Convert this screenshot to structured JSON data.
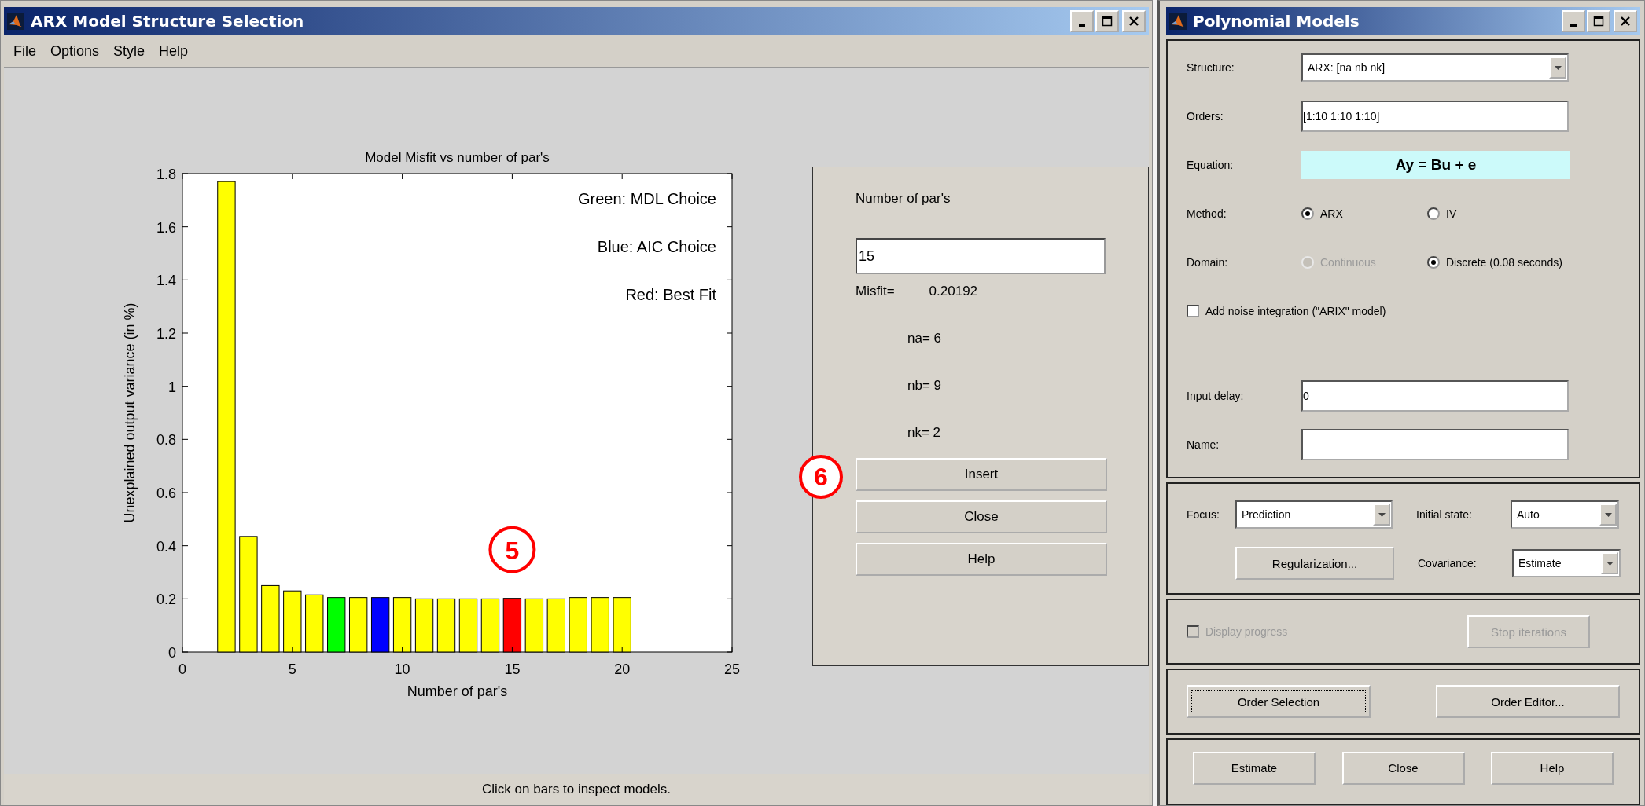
{
  "arx_window": {
    "title": "ARX Model Structure Selection",
    "menu": [
      "File",
      "Options",
      "Style",
      "Help"
    ],
    "chart_data": {
      "type": "bar",
      "title": "Model Misfit vs number of par's",
      "xlabel": "Number of par's",
      "ylabel": "Unexplained output variance (in %)",
      "x": [
        2,
        3,
        4,
        5,
        6,
        7,
        8,
        9,
        10,
        11,
        12,
        13,
        14,
        15,
        16,
        17,
        18,
        19,
        20
      ],
      "series": [
        {
          "color": "#ffff00",
          "values": [
            1.77,
            0.435,
            0.25,
            0.23,
            0.215,
            null,
            0.205,
            null,
            0.205,
            0.2,
            0.2,
            0.2,
            0.2,
            null,
            0.2,
            0.2,
            0.205,
            0.205,
            0.205
          ]
        },
        {
          "name": "Green: MDL Choice",
          "color": "#00ff00",
          "values": [
            null,
            null,
            null,
            null,
            null,
            0.205,
            null,
            null,
            null,
            null,
            null,
            null,
            null,
            null,
            null,
            null,
            null,
            null,
            null
          ]
        },
        {
          "name": "Blue: AIC Choice",
          "color": "#0000ff",
          "values": [
            null,
            null,
            null,
            null,
            null,
            null,
            null,
            0.205,
            null,
            null,
            null,
            null,
            null,
            null,
            null,
            null,
            null,
            null,
            null
          ]
        },
        {
          "name": "Red: Best Fit",
          "color": "#ff0000",
          "values": [
            null,
            null,
            null,
            null,
            null,
            null,
            null,
            null,
            null,
            null,
            null,
            null,
            null,
            0.202,
            null,
            null,
            null,
            null,
            null
          ]
        }
      ],
      "legend": "upper right",
      "xlim": [
        0,
        25
      ],
      "ylim": [
        0,
        1.8
      ],
      "xticks": [
        0,
        5,
        10,
        15,
        20,
        25
      ],
      "yticks": [
        0,
        0.2,
        0.4,
        0.6,
        0.8,
        1,
        1.2,
        1.4,
        1.6,
        1.8
      ]
    },
    "callouts": [
      {
        "label": "5"
      },
      {
        "label": "6"
      }
    ],
    "panel": {
      "heading": "Number of par's",
      "value": "15",
      "misfit_label": "Misfit=",
      "misfit_value": "0.20192",
      "orders": [
        "na= 6",
        "nb= 9",
        "nk= 2"
      ],
      "buttons": [
        "Insert",
        "Close",
        "Help"
      ]
    },
    "status_bar": "Click on bars to inspect models."
  },
  "poly_window": {
    "title": "Polynomial Models",
    "structure": {
      "label": "Structure:",
      "value": "ARX: [na nb nk]"
    },
    "orders": {
      "label": "Orders:",
      "value": "[1:10 1:10 1:10]"
    },
    "equation": {
      "label": "Equation:",
      "value": "Ay = Bu + e"
    },
    "method": {
      "label": "Method:",
      "options": [
        {
          "label": "ARX",
          "selected": true,
          "disabled": false
        },
        {
          "label": "IV",
          "selected": false,
          "disabled": false
        }
      ]
    },
    "domain": {
      "label": "Domain:",
      "options": [
        {
          "label": "Continuous",
          "selected": false,
          "disabled": true
        },
        {
          "label": "Discrete (0.08 seconds)",
          "selected": true,
          "disabled": false
        }
      ]
    },
    "noise_integration": {
      "label": "Add noise integration (\"ARIX\" model)",
      "checked": false,
      "disabled": false
    },
    "input_delay": {
      "label": "Input delay:",
      "value": "0"
    },
    "name": {
      "label": "Name:"
    },
    "focus": {
      "label": "Focus:",
      "value": "Prediction"
    },
    "initial_state": {
      "label": "Initial state:",
      "value": "Auto"
    },
    "regularization_button": "Regularization...",
    "covariance": {
      "label": "Covariance:",
      "value": "Estimate"
    },
    "display_progress": {
      "label": "Display progress",
      "checked": false,
      "disabled": true
    },
    "stop_button": {
      "label": "Stop iterations",
      "disabled": true
    },
    "order_buttons": [
      {
        "label": "Order Selection",
        "focused": true
      },
      {
        "label": "Order Editor...",
        "focused": false
      }
    ],
    "bottom_buttons": [
      "Estimate",
      "Close",
      "Help"
    ]
  }
}
